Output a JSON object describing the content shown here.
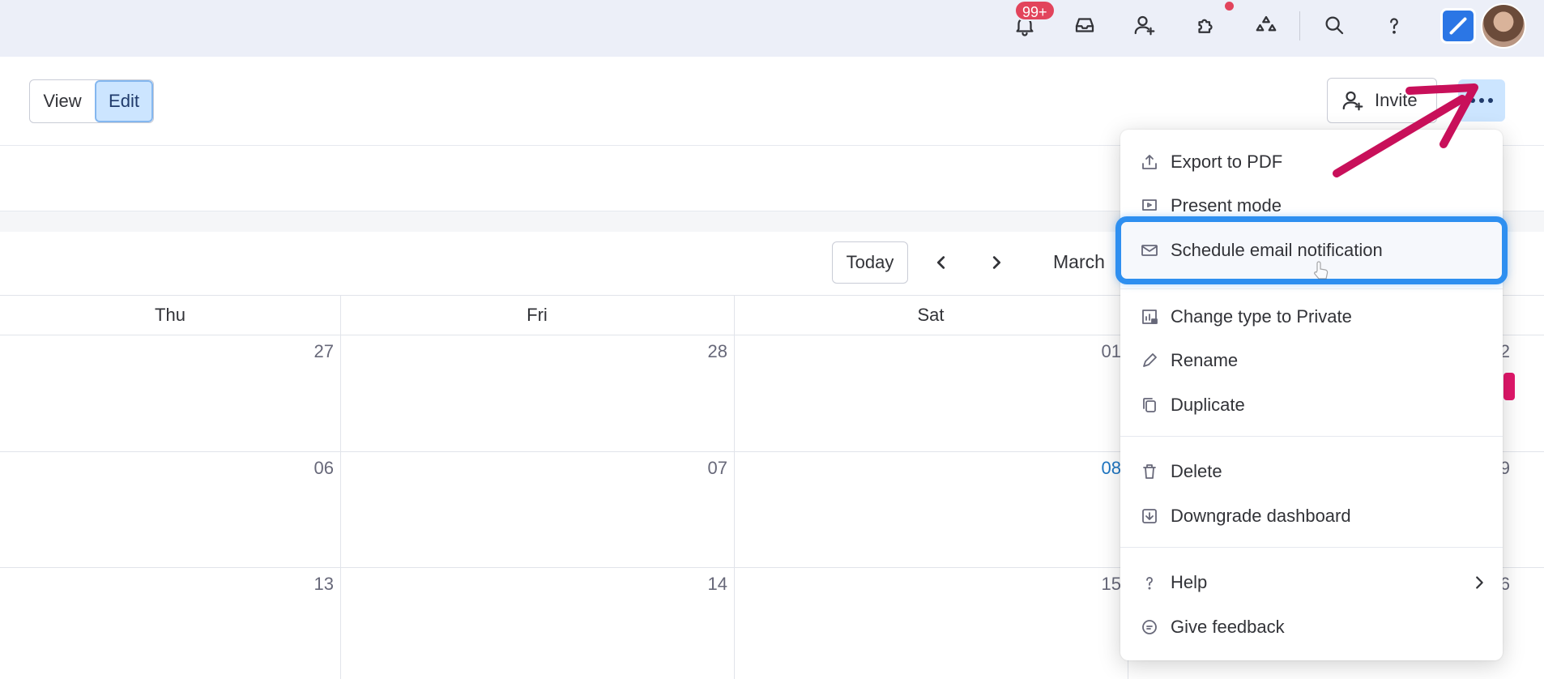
{
  "topbar": {
    "notification_badge": "99+",
    "icons": [
      "bell-icon",
      "inbox-icon",
      "invite-members-icon",
      "integrations-icon",
      "apps-marketplace-icon",
      "search-icon",
      "help-icon"
    ]
  },
  "header": {
    "view_label": "View",
    "edit_label": "Edit",
    "invite_label": "Invite",
    "more_icon": "ellipsis-icon"
  },
  "calendar": {
    "today_label": "Today",
    "month_label": "March",
    "days": [
      "Thu",
      "Fri",
      "Sat"
    ],
    "rows": [
      [
        "27",
        "28",
        "01",
        "2"
      ],
      [
        "06",
        "07",
        "08",
        "9"
      ],
      [
        "13",
        "14",
        "15",
        "6"
      ]
    ],
    "today_color": "#1f76c2"
  },
  "menu": {
    "items": [
      {
        "label": "Export to PDF",
        "icon": "export-icon"
      },
      {
        "label": "Present mode",
        "icon": "present-icon"
      },
      {
        "label": "Schedule email notification",
        "icon": "email-icon"
      },
      {
        "label": "Change type to Private",
        "icon": "private-board-icon"
      },
      {
        "label": "Rename",
        "icon": "pencil-icon"
      },
      {
        "label": "Duplicate",
        "icon": "duplicate-icon"
      },
      {
        "label": "Delete",
        "icon": "trash-icon"
      },
      {
        "label": "Downgrade dashboard",
        "icon": "download-icon"
      },
      {
        "label": "Help",
        "icon": "question-icon"
      },
      {
        "label": "Give feedback",
        "icon": "feedback-icon"
      }
    ]
  },
  "colors": {
    "topbar_bg": "#eceff8",
    "accent_selected": "#cce5ff",
    "highlight_border": "#2e8ff0",
    "annotation_arrow": "#c8105a",
    "badge": "#e2445c"
  }
}
